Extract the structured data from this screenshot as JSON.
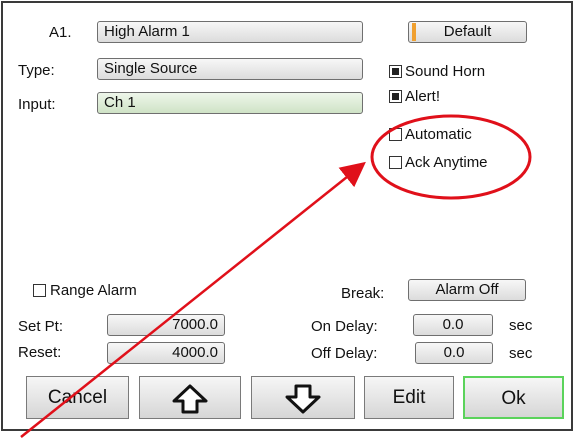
{
  "alarm": {
    "id_label": "A1.",
    "name": "High Alarm 1",
    "default_button": "Default"
  },
  "type": {
    "label": "Type:",
    "value": "Single Source"
  },
  "input": {
    "label": "Input:",
    "value": "Ch 1"
  },
  "options": {
    "sound_horn": {
      "label": "Sound Horn",
      "checked": true
    },
    "alert": {
      "label": "Alert!",
      "checked": true
    },
    "automatic": {
      "label": "Automatic",
      "checked": false
    },
    "ack_anytime": {
      "label": "Ack Anytime",
      "checked": false
    }
  },
  "range_alarm": {
    "label": "Range Alarm",
    "checked": false
  },
  "set_pt": {
    "label": "Set Pt:",
    "value": "7000.0"
  },
  "reset": {
    "label": "Reset:",
    "value": "4000.0"
  },
  "break_field": {
    "label": "Break:",
    "value": "Alarm Off"
  },
  "on_delay": {
    "label": "On Delay:",
    "value": "0.0",
    "unit": "sec"
  },
  "off_delay": {
    "label": "Off Delay:",
    "value": "0.0",
    "unit": "sec"
  },
  "buttons": {
    "cancel": "Cancel",
    "up_icon": "arrow-up-icon",
    "down_icon": "arrow-down-icon",
    "edit": "Edit",
    "ok": "Ok"
  },
  "colors": {
    "annotation": "#e0101a",
    "ok_border": "#5bd35b",
    "input_green": "#cfe3c6",
    "default_tab": "#f0a030"
  }
}
